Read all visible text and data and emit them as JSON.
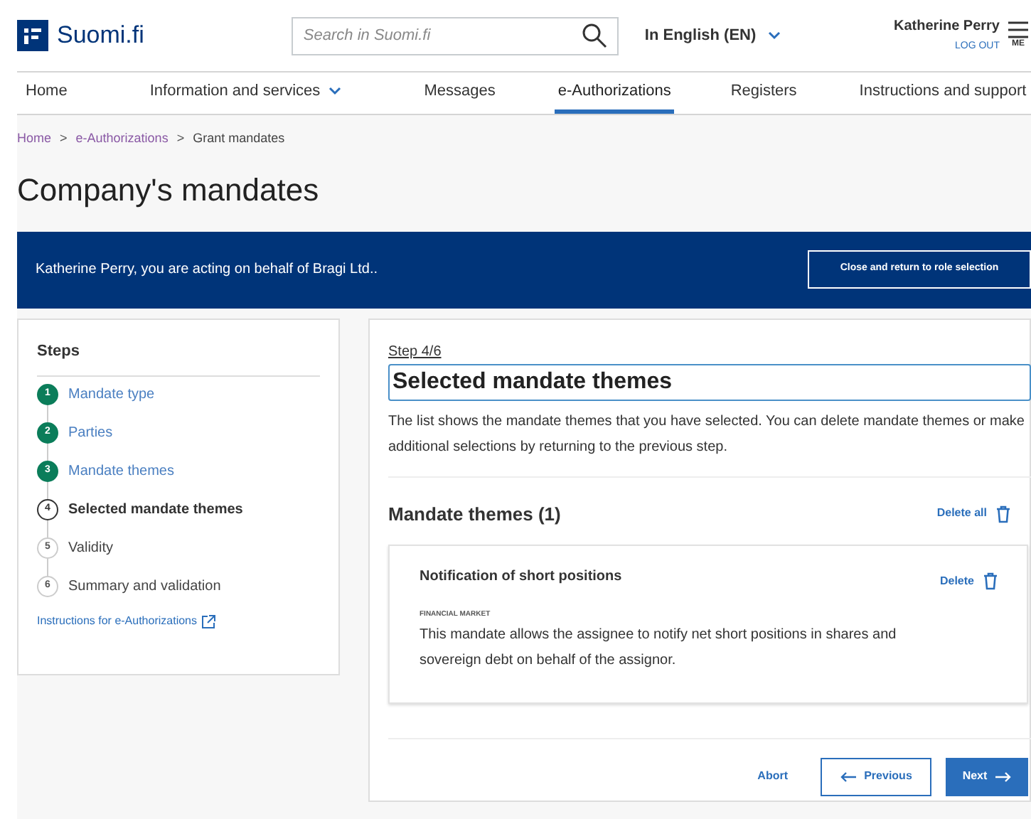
{
  "header": {
    "logo": "Suomi.fi",
    "search": {
      "placeholder": "Search in Suomi.fi"
    },
    "language": "In English (EN)",
    "user": "Katherine Perry",
    "logout": "LOG OUT",
    "menu": "ME"
  },
  "nav": [
    {
      "label": "Home",
      "selected": false,
      "dropdown": false
    },
    {
      "label": "Information and services",
      "selected": false,
      "dropdown": true
    },
    {
      "label": "Messages",
      "selected": false,
      "dropdown": false
    },
    {
      "label": "e-Authorizations",
      "selected": true,
      "dropdown": false
    },
    {
      "label": "Registers",
      "selected": false,
      "dropdown": false
    },
    {
      "label": "Instructions and support",
      "selected": false,
      "dropdown": false
    }
  ],
  "breadcrumb": [
    {
      "label": "Home",
      "link": true,
      "separator": ">"
    },
    {
      "label": "e-Authorizations",
      "link": true,
      "separator": ">"
    },
    {
      "label": "Grant mandates",
      "link": false
    }
  ],
  "page_title": "Company's mandates",
  "banner": {
    "text": "Katherine Perry, you are acting on behalf of Bragi Ltd..",
    "button": "Close and return to role selection"
  },
  "steps": {
    "title": "Steps",
    "items": [
      {
        "number": "1",
        "label": "Mandate type",
        "kind": "done"
      },
      {
        "number": "2",
        "label": "Parties",
        "kind": "done"
      },
      {
        "number": "3",
        "label": "Mandate themes",
        "kind": "done"
      },
      {
        "number": "4",
        "label": "Selected mandate themes",
        "kind": "current"
      },
      {
        "number": "5",
        "label": "Validity",
        "kind": "todo"
      },
      {
        "number": "6",
        "label": "Summary and validation",
        "kind": "todo"
      }
    ],
    "link": "Instructions for e-Authorizations"
  },
  "main": {
    "step": "Step 4/6",
    "title": "Selected mandate themes",
    "intro": "The list shows the mandate themes that you have selected. You can delete mandate themes or make additional selections by returning to the previous step.",
    "section_title": "Mandate themes (1)",
    "delete_all": "Delete all",
    "themes": [
      {
        "title": "Notification of short positions",
        "delete": "Delete",
        "category": "FINANCIAL MARKET",
        "description": "This mandate allows the assignee to notify net short positions in shares and sovereign debt on behalf of the assignor."
      }
    ],
    "buttons": {
      "abort": "Abort",
      "previous": "Previous",
      "next": "Next"
    }
  }
}
